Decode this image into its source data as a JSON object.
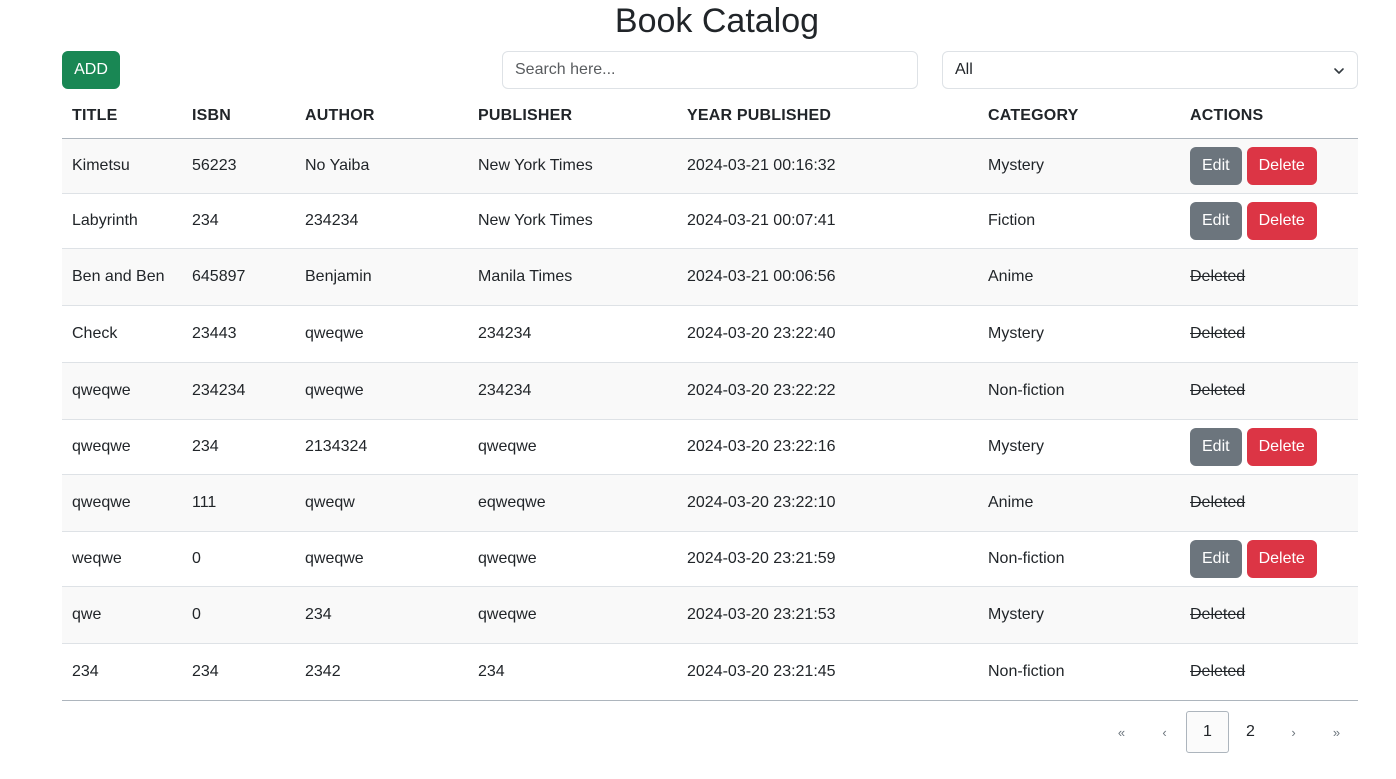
{
  "title": "Book Catalog",
  "toolbar": {
    "add_label": "ADD",
    "search_placeholder": "Search here...",
    "filter_selected": "All"
  },
  "table": {
    "headers": [
      "TITLE",
      "ISBN",
      "AUTHOR",
      "PUBLISHER",
      "YEAR PUBLISHED",
      "CATEGORY",
      "ACTIONS"
    ],
    "edit_label": "Edit",
    "delete_label": "Delete",
    "deleted_label": "Deleted",
    "rows": [
      {
        "title": "Kimetsu",
        "isbn": "56223",
        "author": "No Yaiba",
        "publisher": "New York Times",
        "year": "2024-03-21 00:16:32",
        "category": "Mystery",
        "deleted": false
      },
      {
        "title": "Labyrinth",
        "isbn": "234",
        "author": "234234",
        "publisher": "New York Times",
        "year": "2024-03-21 00:07:41",
        "category": "Fiction",
        "deleted": false
      },
      {
        "title": "Ben and Ben",
        "isbn": "645897",
        "author": "Benjamin",
        "publisher": "Manila Times",
        "year": "2024-03-21 00:06:56",
        "category": "Anime",
        "deleted": true
      },
      {
        "title": "Check",
        "isbn": "23443",
        "author": "qweqwe",
        "publisher": "234234",
        "year": "2024-03-20 23:22:40",
        "category": "Mystery",
        "deleted": true
      },
      {
        "title": "qweqwe",
        "isbn": "234234",
        "author": "qweqwe",
        "publisher": "234234",
        "year": "2024-03-20 23:22:22",
        "category": "Non-fiction",
        "deleted": true
      },
      {
        "title": "qweqwe",
        "isbn": "234",
        "author": "2134324",
        "publisher": "qweqwe",
        "year": "2024-03-20 23:22:16",
        "category": "Mystery",
        "deleted": false
      },
      {
        "title": "qweqwe",
        "isbn": "111",
        "author": "qweqw",
        "publisher": "eqweqwe",
        "year": "2024-03-20 23:22:10",
        "category": "Anime",
        "deleted": true
      },
      {
        "title": "weqwe",
        "isbn": "0",
        "author": "qweqwe",
        "publisher": "qweqwe",
        "year": "2024-03-20 23:21:59",
        "category": "Non-fiction",
        "deleted": false
      },
      {
        "title": "qwe",
        "isbn": "0",
        "author": "234",
        "publisher": "qweqwe",
        "year": "2024-03-20 23:21:53",
        "category": "Mystery",
        "deleted": true
      },
      {
        "title": "234",
        "isbn": "234",
        "author": "2342",
        "publisher": "234",
        "year": "2024-03-20 23:21:45",
        "category": "Non-fiction",
        "deleted": true
      }
    ]
  },
  "pagination": {
    "first": "«",
    "prev": "‹",
    "pages": [
      "1",
      "2"
    ],
    "current": "1",
    "next": "›",
    "last": "»"
  },
  "colors": {
    "add": "#198754",
    "edit": "#6c757d",
    "delete": "#dc3545"
  }
}
